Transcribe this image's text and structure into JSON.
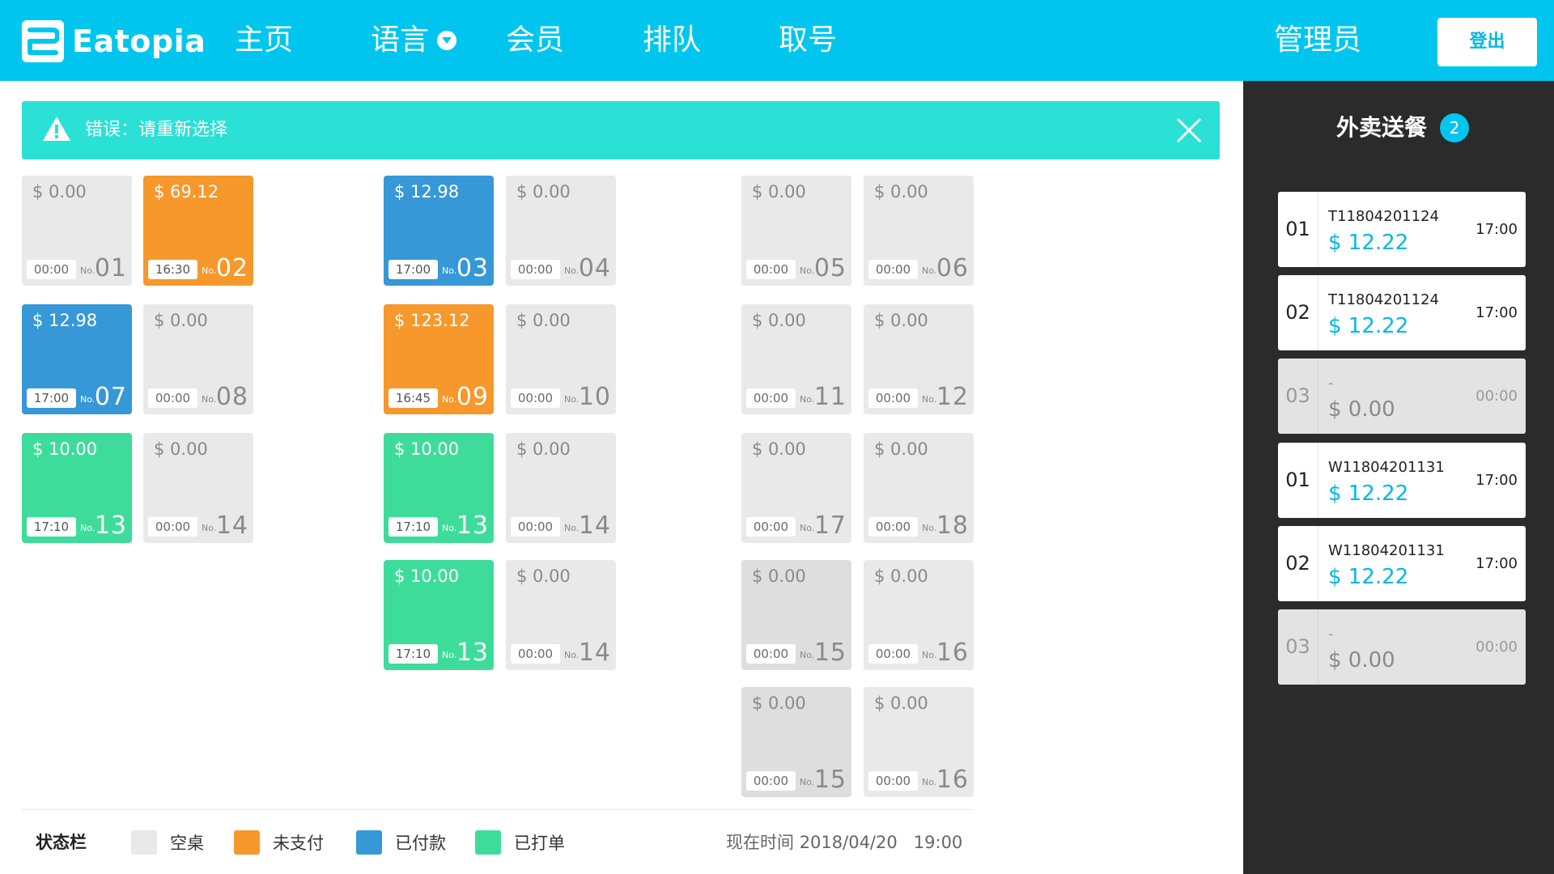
{
  "header": {
    "brand": "Eatopia",
    "nav": [
      {
        "label": "主页"
      },
      {
        "label": "语言"
      },
      {
        "label": "会员"
      },
      {
        "label": "排队"
      },
      {
        "label": "取号"
      }
    ],
    "admin": "管理员",
    "logout": "登出"
  },
  "error": {
    "message": "错误：请重新选择"
  },
  "tables": [
    {
      "amount": "$ 0.00",
      "time": "00:00",
      "no_label": "No.",
      "no": "01",
      "status": "empty"
    },
    {
      "amount": "$ 69.12",
      "time": "16:30",
      "no_label": "No.",
      "no": "02",
      "status": "unpaid"
    },
    {
      "amount": "$ 12.98",
      "time": "17:00",
      "no_label": "No.",
      "no": "03",
      "status": "paid"
    },
    {
      "amount": "$ 0.00",
      "time": "00:00",
      "no_label": "No.",
      "no": "04",
      "status": "empty"
    },
    {
      "amount": "$ 0.00",
      "time": "00:00",
      "no_label": "No.",
      "no": "05",
      "status": "empty"
    },
    {
      "amount": "$ 0.00",
      "time": "00:00",
      "no_label": "No.",
      "no": "06",
      "status": "empty"
    },
    {
      "amount": "$ 12.98",
      "time": "17:00",
      "no_label": "No.",
      "no": "07",
      "status": "paid"
    },
    {
      "amount": "$ 0.00",
      "time": "00:00",
      "no_label": "No.",
      "no": "08",
      "status": "empty"
    },
    {
      "amount": "$ 123.12",
      "time": "16:45",
      "no_label": "No.",
      "no": "09",
      "status": "unpaid"
    },
    {
      "amount": "$ 0.00",
      "time": "00:00",
      "no_label": "No.",
      "no": "10",
      "status": "empty"
    },
    {
      "amount": "$ 0.00",
      "time": "00:00",
      "no_label": "No.",
      "no": "11",
      "status": "empty"
    },
    {
      "amount": "$ 0.00",
      "time": "00:00",
      "no_label": "No.",
      "no": "12",
      "status": "empty"
    },
    {
      "amount": "$ 10.00",
      "time": "17:10",
      "no_label": "No.",
      "no": "13",
      "status": "printed"
    },
    {
      "amount": "$ 0.00",
      "time": "00:00",
      "no_label": "No.",
      "no": "14",
      "status": "empty"
    },
    {
      "amount": "$ 10.00",
      "time": "17:10",
      "no_label": "No.",
      "no": "13",
      "status": "printed"
    },
    {
      "amount": "$ 0.00",
      "time": "00:00",
      "no_label": "No.",
      "no": "14",
      "status": "empty"
    },
    {
      "amount": "$ 0.00",
      "time": "00:00",
      "no_label": "No.",
      "no": "17",
      "status": "empty"
    },
    {
      "amount": "$ 0.00",
      "time": "00:00",
      "no_label": "No.",
      "no": "18",
      "status": "empty"
    },
    {
      "amount": "$ 10.00",
      "time": "17:10",
      "no_label": "No.",
      "no": "13",
      "status": "printed"
    },
    {
      "amount": "$ 0.00",
      "time": "00:00",
      "no_label": "No.",
      "no": "14",
      "status": "empty"
    },
    {
      "amount": "$ 0.00",
      "time": "00:00",
      "no_label": "No.",
      "no": "15",
      "status": "empty"
    },
    {
      "amount": "$ 0.00",
      "time": "00:00",
      "no_label": "No.",
      "no": "16",
      "status": "empty"
    },
    {
      "amount": "$ 0.00",
      "time": "00:00",
      "no_label": "No.",
      "no": "15",
      "status": "empty"
    },
    {
      "amount": "$ 0.00",
      "time": "00:00",
      "no_label": "No.",
      "no": "16",
      "status": "empty"
    }
  ],
  "status_bar": {
    "title": "状态栏",
    "legend": [
      {
        "label": "空桌",
        "color": "#e9e9e9"
      },
      {
        "label": "未支付",
        "color": "#f6982b"
      },
      {
        "label": "已付款",
        "color": "#3798d8"
      },
      {
        "label": "已打单",
        "color": "#3edc9a"
      }
    ],
    "time_label": "现在时间",
    "date": "2018/04/20",
    "time": "19:00"
  },
  "takeout": {
    "title": "外卖送餐",
    "badge": "2",
    "orders": [
      {
        "index": "01",
        "code": "T11804201124",
        "price": "$ 12.22",
        "time": "17:00"
      },
      {
        "index": "02",
        "code": "T11804201124",
        "price": "$ 12.22",
        "time": "17:00"
      },
      {
        "index": "03",
        "code": "-",
        "price": "$ 0.00",
        "time": "00:00"
      },
      {
        "index": "01",
        "code": "W11804201131",
        "price": "$ 12.22",
        "time": "17:00"
      },
      {
        "index": "02",
        "code": "W11804201131",
        "price": "$ 12.22",
        "time": "17:00"
      },
      {
        "index": "03",
        "code": "-",
        "price": "$ 0.00",
        "time": "00:00"
      }
    ]
  },
  "colors": {
    "header": "#00c6ef",
    "error_bar": "#2be0d5",
    "empty": "#e9e9e9",
    "unpaid": "#f6982b",
    "paid": "#3798d8",
    "printed": "#3edc9a",
    "panel": "#2b2b2b",
    "accent_price": "#00b8e8"
  },
  "icons": {
    "logo": "eatopia-logo-icon",
    "language_caret": "chevron-down-circle-icon",
    "warning": "warning-triangle-icon",
    "close": "close-icon"
  }
}
